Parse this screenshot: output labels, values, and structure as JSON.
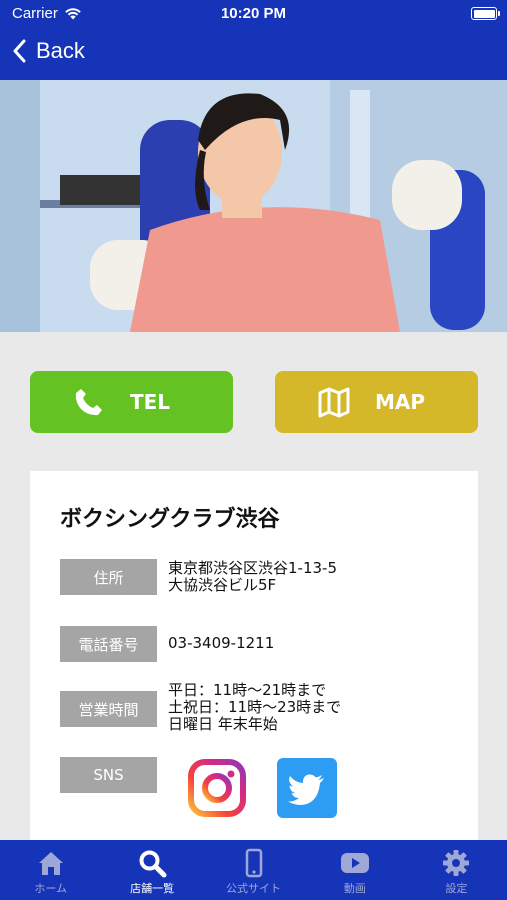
{
  "status_bar": {
    "carrier": "Carrier",
    "time": "10:20 PM"
  },
  "nav": {
    "back_label": "Back"
  },
  "actions": {
    "tel_label": "TEL",
    "map_label": "MAP"
  },
  "shop": {
    "name": "ボクシングクラブ渋谷",
    "address_label": "住所",
    "address_line1": "東京都渋谷区渋谷1-13-5",
    "address_line2": "大協渋谷ビル5F",
    "phone_label": "電話番号",
    "phone": "03-3409-1211",
    "hours_label": "営業時間",
    "hours_line1": "平日：11時～21時まで",
    "hours_line2": "土祝日：11時～23時まで",
    "hours_line3": "日曜日 年末年始",
    "sns_label": "SNS"
  },
  "tabs": [
    {
      "label": "ホーム",
      "icon": "home-icon"
    },
    {
      "label": "店舗一覧",
      "icon": "search-icon"
    },
    {
      "label": "公式サイト",
      "icon": "phone-device-icon"
    },
    {
      "label": "動画",
      "icon": "video-icon"
    },
    {
      "label": "設定",
      "icon": "gear-icon"
    }
  ],
  "colors": {
    "primary": "#1634b8",
    "tel": "#64c322",
    "map": "#d5b72a",
    "label_bg": "#a5a5a5"
  }
}
